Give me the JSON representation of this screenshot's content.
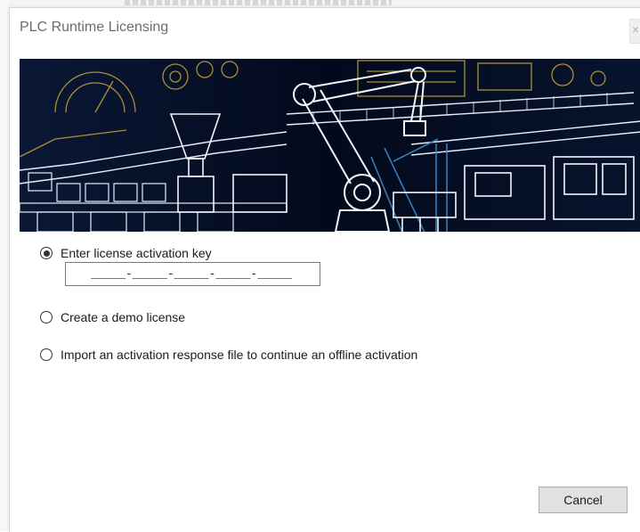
{
  "window": {
    "title": "PLC Runtime Licensing"
  },
  "options": [
    {
      "label": "Enter license activation key",
      "checked": true
    },
    {
      "label": "Create a demo license",
      "checked": false
    },
    {
      "label": "Import an activation response file to continue an offline activation",
      "checked": false
    }
  ],
  "license_key": {
    "mask": "_____-_____-_____-_____-_____"
  },
  "buttons": {
    "cancel": "Cancel"
  },
  "banner": {
    "background": "#02091c",
    "line_color": "#ffffff",
    "accent_color": "#c9a53a",
    "blue_color": "#3b88c9"
  }
}
